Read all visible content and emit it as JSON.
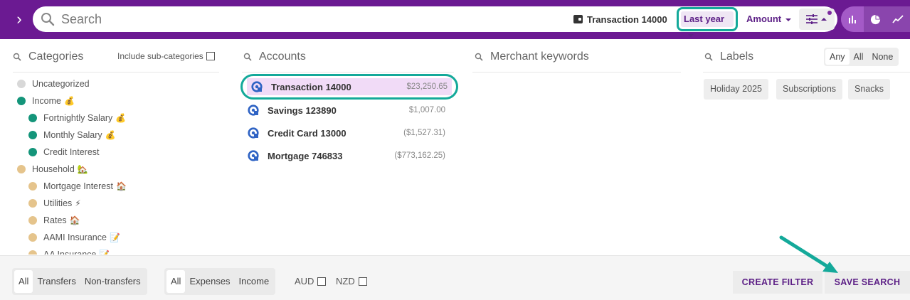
{
  "topbar": {
    "search": {
      "placeholder": "Search",
      "value": ""
    },
    "account_chip": "Transaction 14000",
    "date_filter": "Last year",
    "amount_filter": "Amount"
  },
  "categories": {
    "title": "Categories",
    "include_sub_label": "Include sub-categories",
    "items": [
      {
        "label": "Uncategorized",
        "emoji": "",
        "color": "#d8d8d8",
        "level": 0
      },
      {
        "label": "Income",
        "emoji": "💰",
        "color": "#14957a",
        "level": 0
      },
      {
        "label": "Fortnightly Salary",
        "emoji": "💰",
        "color": "#14957a",
        "level": 1
      },
      {
        "label": "Monthly Salary",
        "emoji": "💰",
        "color": "#14957a",
        "level": 1
      },
      {
        "label": "Credit Interest",
        "emoji": "",
        "color": "#14957a",
        "level": 1
      },
      {
        "label": "Household",
        "emoji": "🏡",
        "color": "#e5c48c",
        "level": 0
      },
      {
        "label": "Mortgage Interest",
        "emoji": "🏠",
        "color": "#e5c48c",
        "level": 1
      },
      {
        "label": "Utilities",
        "emoji": "⚡",
        "color": "#e5c48c",
        "level": 1
      },
      {
        "label": "Rates",
        "emoji": "🏠",
        "color": "#e5c48c",
        "level": 1
      },
      {
        "label": "AAMI Insurance",
        "emoji": "📝",
        "color": "#e5c48c",
        "level": 1
      },
      {
        "label": "AA Insurance",
        "emoji": "📝",
        "color": "#e5c48c",
        "level": 1
      }
    ]
  },
  "accounts": {
    "title": "Accounts",
    "items": [
      {
        "name": "Transaction 14000",
        "balance": "$23,250.65",
        "selected": true
      },
      {
        "name": "Savings 123890",
        "balance": "$1,007.00",
        "selected": false
      },
      {
        "name": "Credit Card 13000",
        "balance": "($1,527.31)",
        "selected": false
      },
      {
        "name": "Mortgage 746833",
        "balance": "($773,162.25)",
        "selected": false
      }
    ]
  },
  "merchants": {
    "title": "Merchant keywords"
  },
  "labels": {
    "title": "Labels",
    "match_options": [
      "Any",
      "All",
      "None"
    ],
    "match_selected": "Any",
    "chips": [
      "Holiday 2025",
      "Subscriptions",
      "Snacks"
    ]
  },
  "footer": {
    "transfer_filter": [
      "All",
      "Transfers",
      "Non-transfers"
    ],
    "type_filter": [
      "All",
      "Expenses",
      "Income"
    ],
    "currencies": [
      "AUD",
      "NZD"
    ],
    "create_filter": "CREATE FILTER",
    "save_search": "SAVE SEARCH"
  },
  "colors": {
    "brand": "#6b1a92",
    "highlight": "#14a99a",
    "accent_text": "#5c1f86"
  }
}
